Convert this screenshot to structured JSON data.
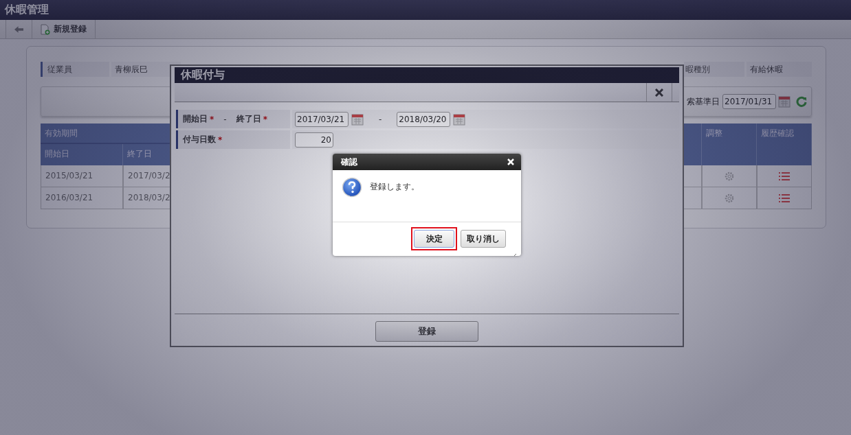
{
  "app_title": "休暇管理",
  "toolbar": {
    "new_button": "新規登録"
  },
  "employee": {
    "label": "従業員",
    "value": "青柳辰巳"
  },
  "leave_type": {
    "label": "暇種別",
    "value": "有給休暇"
  },
  "search": {
    "label": "索基準日",
    "value": "2017/01/31"
  },
  "table": {
    "group_header": "有効期間",
    "columns_left": [
      "開始日",
      "終了日"
    ],
    "columns_right": [
      "調整",
      "履歴確認"
    ],
    "rows": [
      {
        "start": "2015/03/21",
        "end": "2017/03/2"
      },
      {
        "start": "2016/03/21",
        "end": "2018/03/2"
      }
    ]
  },
  "modal": {
    "title": "休暇付与",
    "fields": [
      {
        "kind": "date_range",
        "label": "開始日",
        "required_mark": "*",
        "separator": "-",
        "label_end": "終了日",
        "value": "2017/03/21",
        "value_end": "2018/03/20"
      },
      {
        "kind": "number",
        "label": "付与日数",
        "required_mark": "*",
        "value": "20"
      }
    ],
    "submit": "登録"
  },
  "confirm": {
    "title": "確認",
    "message": "登録します。",
    "buttons": [
      {
        "label": "決定",
        "highlighted": true
      },
      {
        "label": "取り消し",
        "highlighted": false
      }
    ]
  }
}
